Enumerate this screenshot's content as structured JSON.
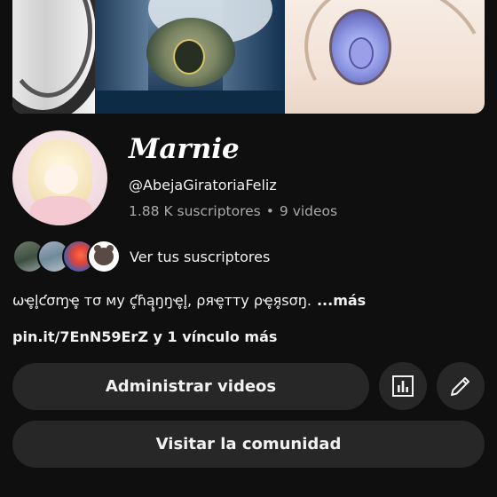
{
  "channel": {
    "name": "Marnie",
    "handle": "@AbejaGiratoriaFeliz",
    "subscribers": "1.88 K suscriptores",
    "separator": "•",
    "videos": "9 videos"
  },
  "subscribers_preview": {
    "label": "Ver tus suscriptores"
  },
  "description": {
    "text": "ωҽ̥l̥ƈσɱҽ̥ тσ мy ƈ̥ɦą̥ŋŋҽ̥l̥, ρяҽ̥тту ρҽ̥я̥ѕσŋ.",
    "more": "...más"
  },
  "links": {
    "text": "pin.it/7EnN59ErZ y 1 vínculo más"
  },
  "actions": {
    "manage_label": "Administrar videos",
    "community_label": "Visitar la comunidad",
    "analytics_icon": "analytics-icon",
    "edit_icon": "pencil-icon"
  },
  "colors": {
    "background": "#0f0f0f",
    "button": "#272727",
    "secondary_text": "#aaaaaa"
  }
}
